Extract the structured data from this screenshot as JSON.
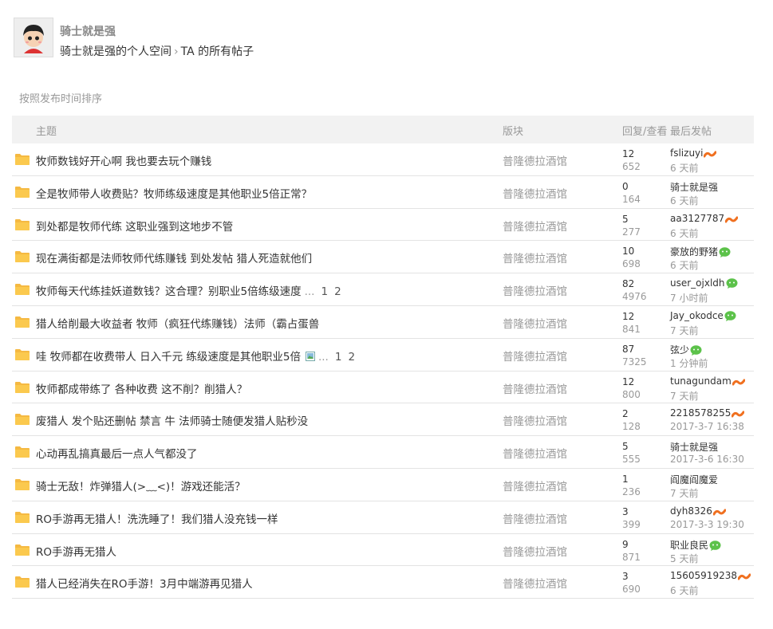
{
  "profile": {
    "username": "骑士就是强",
    "breadcrumb_space": "骑士就是强的个人空间",
    "breadcrumb_sep": "›",
    "breadcrumb_current": "TA 的所有帖子"
  },
  "sort_label": "按照发布时间排序",
  "table": {
    "col_topic": "主题",
    "col_forum": "版块",
    "col_stats": "回复/查看",
    "col_last": "最后发帖"
  },
  "threads": [
    {
      "title": "牧师数钱好开心啊 我也要去玩个赚钱",
      "forum": "普隆德拉酒馆",
      "replies": "12",
      "views": "652",
      "last_user": "fslizuyi",
      "last_time": "6 天前",
      "icon": "weibo-icon"
    },
    {
      "title": "全是牧师带人收费贴？牧师练级速度是其他职业5倍正常？",
      "forum": "普隆德拉酒馆",
      "replies": "0",
      "views": "164",
      "last_user": "骑士就是强",
      "last_time": "6 天前",
      "icon": ""
    },
    {
      "title": "到处都是牧师代练 这职业强到这地步不管",
      "forum": "普隆德拉酒馆",
      "replies": "5",
      "views": "277",
      "last_user": "aa3127787",
      "last_time": "6 天前",
      "icon": "weibo-icon"
    },
    {
      "title": "现在满街都是法师牧师代练赚钱 到处发帖 猎人死造就他们",
      "forum": "普隆德拉酒馆",
      "replies": "10",
      "views": "698",
      "last_user": "豪放的野猪",
      "last_time": "6 天前",
      "icon": "wechat-icon"
    },
    {
      "title": "牧师每天代练挂妖道数钱？这合理？别职业5倍练级速度",
      "forum": "普隆德拉酒馆",
      "replies": "82",
      "views": "4976",
      "last_user": "user_ojxldh",
      "last_time": "7 小时前",
      "icon": "wechat-icon",
      "dots": "...",
      "pages": [
        "1",
        "2"
      ]
    },
    {
      "title": "猎人给削最大收益者 牧师（疯狂代练赚钱）法师（霸占蛋兽",
      "forum": "普隆德拉酒馆",
      "replies": "12",
      "views": "841",
      "last_user": "Jay_okodce",
      "last_time": "7 天前",
      "icon": "wechat-icon"
    },
    {
      "title": "哇 牧师都在收费带人 日入千元 练级速度是其他职业5倍",
      "forum": "普隆德拉酒馆",
      "replies": "87",
      "views": "7325",
      "last_user": "弦少",
      "last_time": "1 分钟前",
      "icon": "wechat-icon",
      "image": true,
      "dots": "...",
      "pages": [
        "1",
        "2"
      ]
    },
    {
      "title": "牧师都成带练了 各种收费 这不削？削猎人？",
      "forum": "普隆德拉酒馆",
      "replies": "12",
      "views": "800",
      "last_user": "tunagundam",
      "last_time": "7 天前",
      "icon": "weibo-icon"
    },
    {
      "title": "废猎人 发个贴还删帖 禁言 牛 法师骑士随便发猎人贴秒没",
      "forum": "普隆德拉酒馆",
      "replies": "2",
      "views": "128",
      "last_user": "2218578255",
      "last_time": "2017-3-7 16:38",
      "icon": "weibo-icon"
    },
    {
      "title": "心动再乱搞真最后一点人气都没了",
      "forum": "普隆德拉酒馆",
      "replies": "5",
      "views": "555",
      "last_user": "骑士就是强",
      "last_time": "2017-3-6 16:30",
      "icon": ""
    },
    {
      "title": "骑士无敌！炸弹猎人(&gt;﹏&lt;)！游戏还能活？",
      "forum": "普隆德拉酒馆",
      "replies": "1",
      "views": "236",
      "last_user": "阎魔阎魔爱",
      "last_time": "7 天前",
      "icon": ""
    },
    {
      "title": "RO手游再无猎人！洗洗睡了！我们猎人没充钱一样",
      "forum": "普隆德拉酒馆",
      "replies": "3",
      "views": "399",
      "last_user": "dyh8326",
      "last_time": "2017-3-3 19:30",
      "icon": "weibo-icon"
    },
    {
      "title": "RO手游再无猎人",
      "forum": "普隆德拉酒馆",
      "replies": "9",
      "views": "871",
      "last_user": "职业良民",
      "last_time": "5 天前",
      "icon": "wechat-icon"
    },
    {
      "title": "猎人已经消失在RO手游！3月中端游再见猎人",
      "forum": "普隆德拉酒馆",
      "replies": "3",
      "views": "690",
      "last_user": "15605919238",
      "last_time": "6 天前",
      "icon": "weibo-icon"
    }
  ]
}
